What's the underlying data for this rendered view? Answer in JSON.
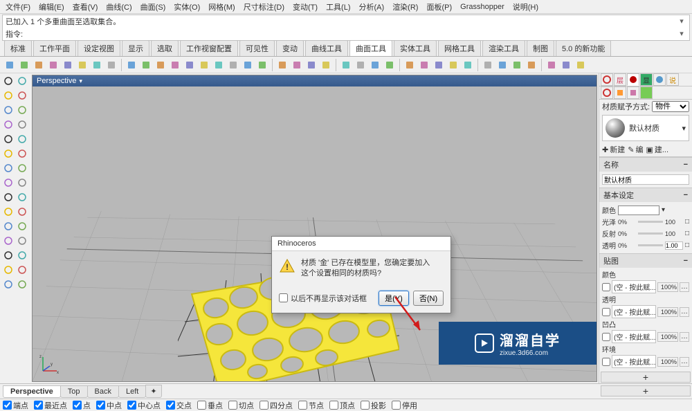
{
  "menubar": [
    "文件(F)",
    "编辑(E)",
    "查看(V)",
    "曲线(C)",
    "曲面(S)",
    "实体(O)",
    "网格(M)",
    "尺寸标注(D)",
    "变动(T)",
    "工具(L)",
    "分析(A)",
    "渲染(R)",
    "面板(P)",
    "Grasshopper",
    "说明(H)"
  ],
  "command_history": "已加入 1 个多重曲面至选取集合。",
  "command_prompt_label": "指令:",
  "command_input": "",
  "tabs": [
    "标准",
    "工作平面",
    "设定视图",
    "显示",
    "选取",
    "工作视窗配置",
    "可见性",
    "变动",
    "曲线工具",
    "曲面工具",
    "实体工具",
    "网格工具",
    "渲染工具",
    "制图",
    "5.0 的新功能"
  ],
  "active_tab": "曲面工具",
  "viewport_title": "Perspective",
  "right_panel": {
    "assign_label": "材质赋予方式:",
    "assign_select": "物件",
    "mat_name": "默认材质",
    "btn_new": "新建",
    "btn_edit": "编",
    "btn_build": "建...",
    "section_name": "名称",
    "name_value": "默认材质",
    "section_basic": "基本设定",
    "color_label": "颜色",
    "gloss_label": "光泽",
    "reflect_label": "反射",
    "trans_label": "透明",
    "pct0": "0%",
    "pct100": "100",
    "ior_value": "1.00",
    "section_maps": "贴图",
    "map_color_label": "颜色",
    "map_trans_label": "透明",
    "map_bump_label": "凹凸",
    "map_env_label": "环境",
    "map_placeholder": "(空 - 按此赋...",
    "map_pct": "100%"
  },
  "dialog": {
    "title": "Rhinoceros",
    "message_l1": "材质 '金' 已存在模型里，您确定要加入",
    "message_l2": "这个设置相同的材质吗?",
    "dont_show": "以后不再显示该对话框",
    "yes": "是(Y)",
    "no": "否(N)"
  },
  "view_tabs": [
    "Perspective",
    "Top",
    "Back",
    "Left"
  ],
  "osnaps": [
    {
      "label": "端点",
      "checked": true
    },
    {
      "label": "最近点",
      "checked": true
    },
    {
      "label": "点",
      "checked": true
    },
    {
      "label": "中点",
      "checked": true
    },
    {
      "label": "中心点",
      "checked": true
    },
    {
      "label": "交点",
      "checked": true
    },
    {
      "label": "垂点",
      "checked": false
    },
    {
      "label": "切点",
      "checked": false
    },
    {
      "label": "四分点",
      "checked": false
    },
    {
      "label": "节点",
      "checked": false
    },
    {
      "label": "顶点",
      "checked": false
    },
    {
      "label": "投影",
      "checked": false
    },
    {
      "label": "停用",
      "checked": false
    }
  ],
  "watermark": {
    "brand": "溜溜自学",
    "url": "zixue.3d66.com"
  },
  "colors": {
    "accent_yellow": "#f5e63b",
    "dialog_primary": "#2b74c7",
    "watermark_bg": "#1b4e86",
    "arrow": "#d11b1b"
  }
}
